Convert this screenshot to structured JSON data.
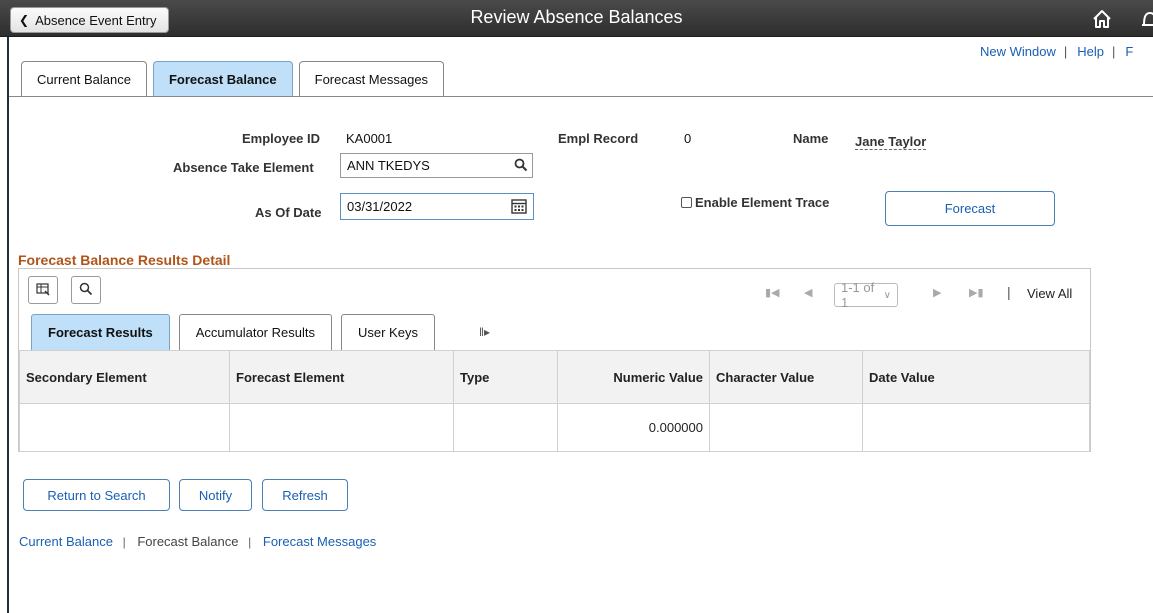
{
  "header": {
    "back_label": "Absence Event Entry",
    "title": "Review Absence Balances"
  },
  "utility_links": {
    "new_window": "New Window",
    "help": "Help",
    "sep": "|",
    "partial": "F"
  },
  "page_tabs": [
    {
      "label": "Current Balance",
      "active": false
    },
    {
      "label": "Forecast Balance",
      "active": true
    },
    {
      "label": "Forecast Messages",
      "active": false
    }
  ],
  "form": {
    "employee_id_label": "Employee ID",
    "employee_id": "KA0001",
    "empl_record_label": "Empl Record",
    "empl_record": "0",
    "name_label": "Name",
    "name": "Jane Taylor",
    "absence_take_label": "Absence Take Element",
    "absence_take_value": "ANN TKEDYS",
    "as_of_date_label": "As Of Date",
    "as_of_date": "03/31/2022",
    "enable_trace_label": "Enable Element Trace",
    "enable_trace_checked": false,
    "forecast_button": "Forecast"
  },
  "grid": {
    "title": "Forecast Balance Results Detail",
    "pager": "1-1 of 1",
    "view_all": "View All",
    "separator": "|",
    "tabs": [
      {
        "label": "Forecast Results",
        "active": true
      },
      {
        "label": "Accumulator Results",
        "active": false
      },
      {
        "label": "User Keys",
        "active": false
      }
    ],
    "columns": [
      "Secondary Element",
      "Forecast Element",
      "Type",
      "Numeric Value",
      "Character Value",
      "Date Value"
    ],
    "rows": [
      {
        "secondary": "",
        "forecast": "",
        "type": "",
        "numeric": "0.000000",
        "character": "",
        "date": ""
      }
    ]
  },
  "buttons": {
    "return_to_search": "Return to Search",
    "notify": "Notify",
    "refresh": "Refresh"
  },
  "footer_links": {
    "current_balance": "Current Balance",
    "forecast_balance": "Forecast Balance",
    "forecast_messages": "Forecast Messages",
    "sep": "|"
  },
  "colors": {
    "header_bg": "#3a3a3a",
    "active_tab": "#bfe0f8",
    "link": "#1a5fb4",
    "section_title": "#b0541a"
  }
}
